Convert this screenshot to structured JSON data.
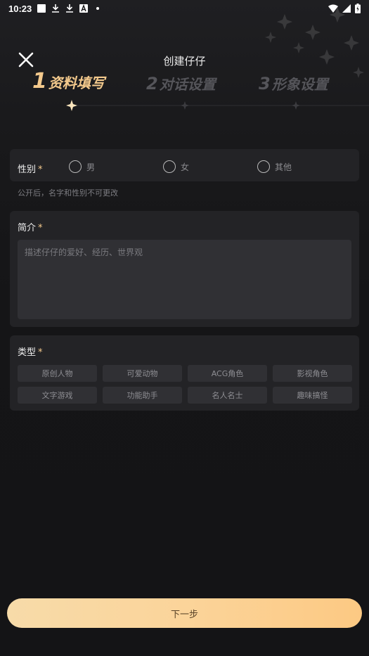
{
  "status_bar": {
    "time": "10:23",
    "left_icons": [
      "notification-square-icon",
      "download-icon",
      "download-icon",
      "font-a-icon",
      "dot-icon"
    ],
    "right_icons": [
      "wifi-icon",
      "signal-icon",
      "battery-icon"
    ]
  },
  "header": {
    "close_icon": "close-icon",
    "title": "创建仔仔"
  },
  "steps": [
    {
      "number": "1",
      "label": "资料填写",
      "active": true
    },
    {
      "number": "2",
      "label": "对话设置",
      "active": false
    },
    {
      "number": "3",
      "label": "形象设置",
      "active": false
    }
  ],
  "gender": {
    "label": "性别",
    "required_mark": "*",
    "options": [
      "男",
      "女",
      "其他"
    ],
    "selected": null,
    "hint": "公开后，名字和性别不可更改"
  },
  "intro": {
    "label": "简介",
    "required_mark": "*",
    "value": "",
    "placeholder": "描述仔仔的爱好、经历、世界观"
  },
  "type": {
    "label": "类型",
    "required_mark": "*",
    "tags": [
      "原创人物",
      "可爱动物",
      "ACG角色",
      "影视角色",
      "文字游戏",
      "功能助手",
      "名人名士",
      "趣味搞怪"
    ]
  },
  "footer": {
    "next_label": "下一步"
  },
  "colors": {
    "accent_gold": "#f3c98c",
    "button_gradient_start": "#f7dba9",
    "button_gradient_end": "#fcc983",
    "background": "#141416",
    "card": "#232326"
  }
}
